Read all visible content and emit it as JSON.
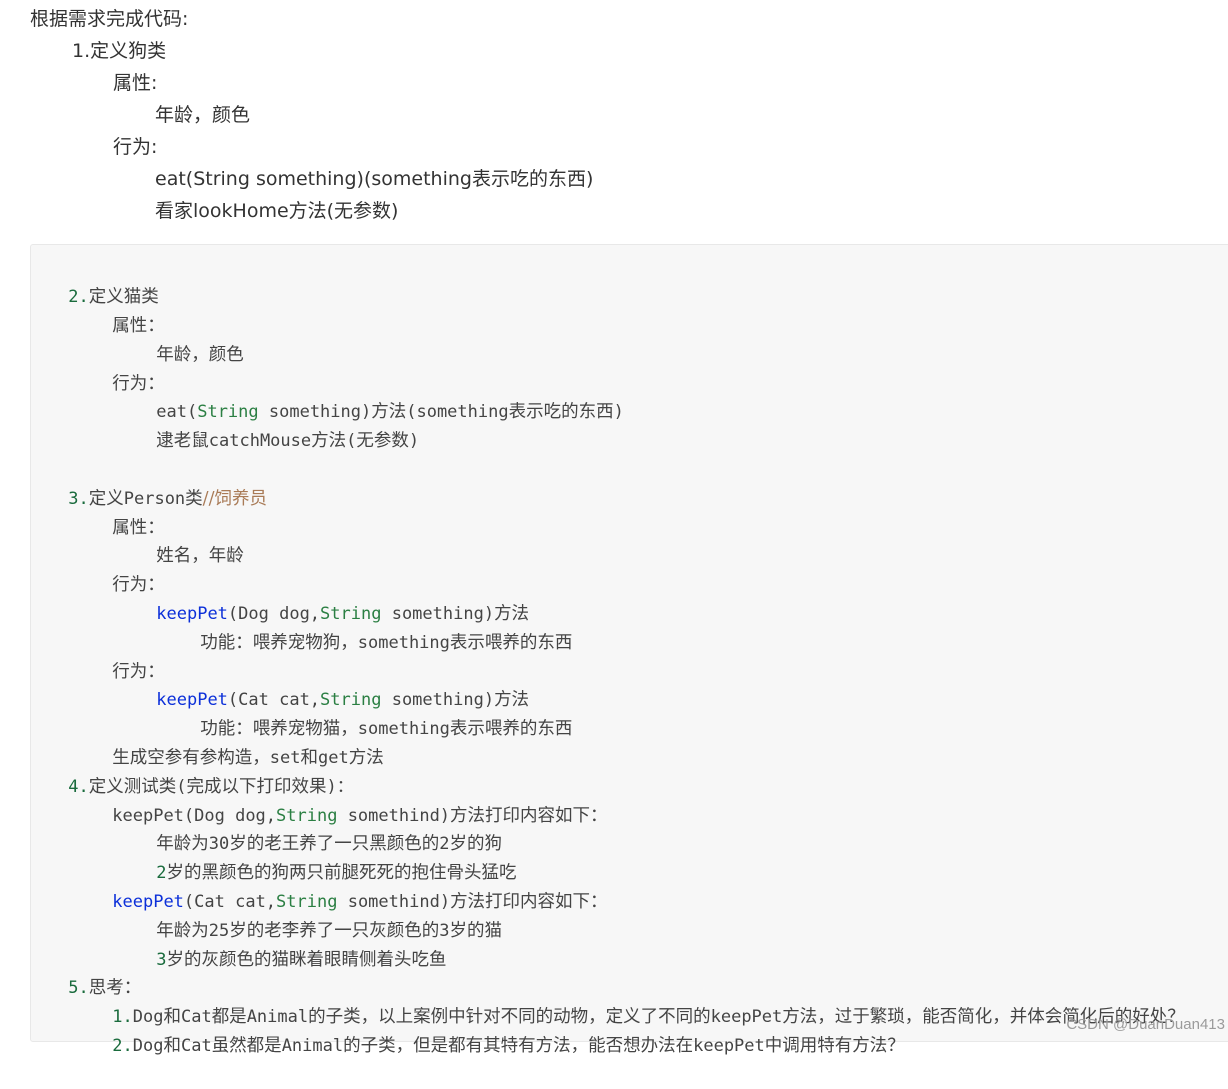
{
  "intro": {
    "l1": "根据需求完成代码:",
    "l2": "1.定义狗类",
    "l3": "属性:",
    "l4": "年龄，颜色",
    "l5": "行为:",
    "l6": "eat(String something)(something表示吃的东西)",
    "l7": "看家lookHome方法(无参数)"
  },
  "code": {
    "c1_num": "2.",
    "c1_text": "定义猫类",
    "c2": "属性：",
    "c3": "年龄，颜色",
    "c4": "行为：",
    "c5_a": "eat(",
    "c5_b": "String",
    "c5_c": " something)",
    "c5_d": "方法",
    "c5_e": "(something",
    "c5_f": "表示吃的东西",
    "c5_g": ")",
    "c6_a": "逮老鼠",
    "c6_b": "catchMouse",
    "c6_c": "方法",
    "c6_d": "(",
    "c6_e": "无参数",
    "c6_f": ")",
    "c7_num": "3.",
    "c7_a": "定义",
    "c7_b": "Person",
    "c7_c": "类",
    "c7_d": "//饲养员",
    "c8": "属性：",
    "c9": "姓名，年龄",
    "c10": "行为：",
    "c11_a": "keepPet",
    "c11_b": "(Dog dog,",
    "c11_c": "String",
    "c11_d": " something)",
    "c11_e": "方法",
    "c12_a": "功能：喂养宠物狗，",
    "c12_b": "something",
    "c12_c": "表示喂养的东西",
    "c13": "行为：",
    "c14_a": "keepPet",
    "c14_b": "(Cat cat,",
    "c14_c": "String",
    "c14_d": " something)",
    "c14_e": "方法",
    "c15_a": "功能：喂养宠物猫，",
    "c15_b": "something",
    "c15_c": "表示喂养的东西",
    "c16_a": "生成空参有参构造，",
    "c16_b": "set",
    "c16_c": "和",
    "c16_d": "get",
    "c16_e": "方法",
    "c17_num": "4.",
    "c17_a": "定义测试类",
    "c17_b": "(",
    "c17_c": "完成以下打印效果",
    "c17_d": ")：",
    "c18_a": "keepPet(Dog dog,",
    "c18_b": "String",
    "c18_c": " somethind)",
    "c18_d": "方法打印内容如下：",
    "c19_a": "年龄为",
    "c19_b": "30",
    "c19_c": "岁的老王养了一只黑颜色的",
    "c19_d": "2",
    "c19_e": "岁的狗",
    "c20_a": "2",
    "c20_b": "岁的黑颜色的狗两只前腿死死的抱住骨头猛吃",
    "c21_a": "keepPet",
    "c21_b": "(Cat cat,",
    "c21_c": "String",
    "c21_d": " somethind)",
    "c21_e": "方法打印内容如下：",
    "c22_a": "年龄为",
    "c22_b": "25",
    "c22_c": "岁的老李养了一只灰颜色的",
    "c22_d": "3",
    "c22_e": "岁的猫",
    "c23_a": "3",
    "c23_b": "岁的灰颜色的猫眯着眼睛侧着头吃鱼",
    "c24_num": "5.",
    "c24_a": "思考：",
    "c25_num": "1.",
    "c25_a": "Dog",
    "c25_b": "和",
    "c25_c": "Cat",
    "c25_d": "都是",
    "c25_e": "Animal",
    "c25_f": "的子类，以上案例中针对不同的动物，定义了不同的",
    "c25_g": "keepPet",
    "c25_h": "方法，过于繁琐，能否简化，并体会简化后的好处？",
    "c26_num": "2.",
    "c26_a": "Dog",
    "c26_b": "和",
    "c26_c": "Cat",
    "c26_d": "虽然都是",
    "c26_e": "Animal",
    "c26_f": "的子类，但是都有其特有方法，能否想办法在",
    "c26_g": "keepPet",
    "c26_h": "中调用特有方法？"
  },
  "watermark": "CSDN @DuanDuan413",
  "colors": {
    "number": "#1a6b3d",
    "keyword": "#2b7f43",
    "function": "#0b2fd9",
    "comment": "#a97b57"
  }
}
